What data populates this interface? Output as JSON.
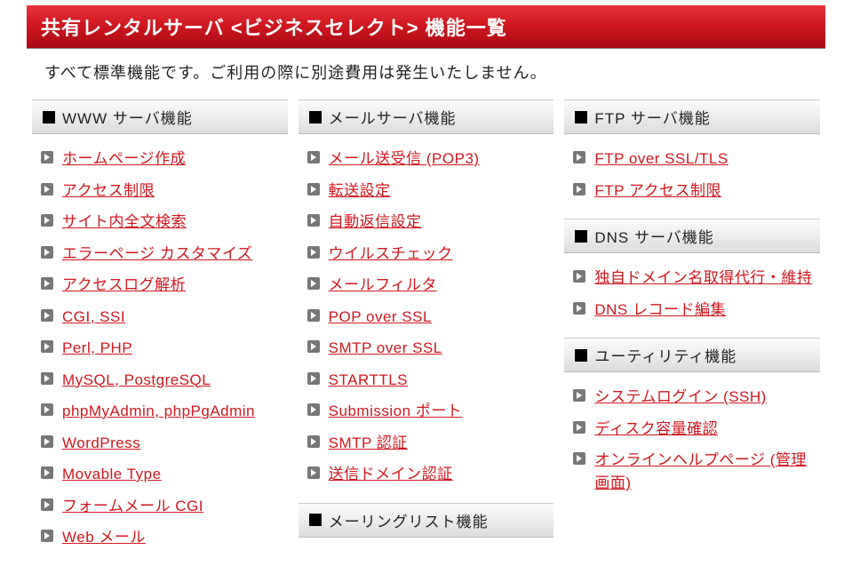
{
  "header_title": "共有レンタルサーバ <ビジネスセレクト> 機能一覧",
  "intro_text": "すべて標準機能です。ご利用の際に別途費用は発生いたしません。",
  "columns": [
    {
      "sections": [
        {
          "title": "WWW サーバ機能",
          "items": [
            "ホームページ作成",
            "アクセス制限",
            "サイト内全文検索",
            "エラーページ カスタマイズ",
            "アクセスログ解析",
            "CGI, SSI",
            "Perl, PHP",
            "MySQL, PostgreSQL",
            "phpMyAdmin, phpPgAdmin",
            "WordPress",
            "Movable Type",
            "フォームメール CGI",
            "Web メール"
          ]
        }
      ]
    },
    {
      "sections": [
        {
          "title": "メールサーバ機能",
          "items": [
            "メール送受信 (POP3)",
            "転送設定",
            "自動返信設定",
            "ウイルスチェック",
            "メールフィルタ",
            "POP over SSL",
            "SMTP over SSL",
            "STARTTLS",
            "Submission ポート",
            "SMTP 認証",
            "送信ドメイン認証"
          ]
        },
        {
          "title": "メーリングリスト機能",
          "items": []
        }
      ]
    },
    {
      "sections": [
        {
          "title": "FTP サーバ機能",
          "items": [
            "FTP over SSL/TLS",
            "FTP アクセス制限"
          ]
        },
        {
          "title": "DNS サーバ機能",
          "items": [
            "独自ドメイン名取得代行・維持",
            "DNS レコード編集"
          ]
        },
        {
          "title": "ユーティリティ機能",
          "items": [
            "システムログイン (SSH)",
            "ディスク容量確認",
            "オンラインヘルプページ (管理画面)"
          ]
        }
      ]
    }
  ]
}
